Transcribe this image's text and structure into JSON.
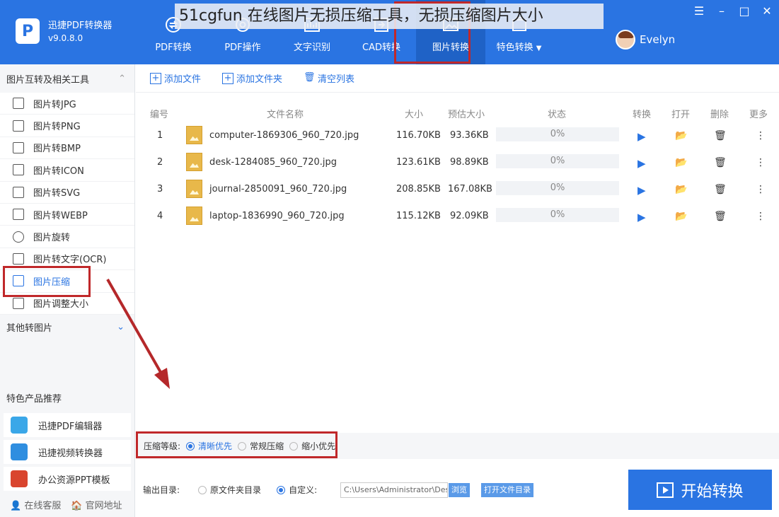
{
  "app": {
    "name": "迅捷PDF转换器",
    "version": "v9.0.8.0",
    "logo_letter": "P"
  },
  "watermark": "51cgfun 在线图片无损压缩工具，无损压缩图片大小",
  "nav": [
    {
      "label": "PDF转换",
      "icon": "convert-icon"
    },
    {
      "label": "PDF操作",
      "icon": "settings-icon"
    },
    {
      "label": "文字识别",
      "icon": "ocr-icon"
    },
    {
      "label": "CAD转换",
      "icon": "cad-icon"
    },
    {
      "label": "图片转换",
      "icon": "image-icon",
      "active": true
    },
    {
      "label": "特色转换",
      "icon": "special-icon",
      "dropdown": "▼"
    }
  ],
  "window_controls": {
    "menu": "☰",
    "minimize": "–",
    "maximize": "□",
    "close": "✕"
  },
  "user": {
    "name": "Evelyn"
  },
  "sidebar": {
    "section1": "图片互转及相关工具",
    "section1_toggle": "⌃",
    "items": [
      {
        "label": "图片转JPG"
      },
      {
        "label": "图片转PNG"
      },
      {
        "label": "图片转BMP"
      },
      {
        "label": "图片转ICON"
      },
      {
        "label": "图片转SVG"
      },
      {
        "label": "图片转WEBP"
      },
      {
        "label": "图片旋转"
      },
      {
        "label": "图片转文字(OCR)"
      },
      {
        "label": "图片压缩",
        "active": true
      },
      {
        "label": "图片调整大小"
      }
    ],
    "section2": "其他转图片",
    "section2_toggle": "⌄",
    "featured_title": "特色产品推荐",
    "featured": [
      {
        "label": "迅捷PDF编辑器",
        "color": "#3aa7e8"
      },
      {
        "label": "迅捷视频转换器",
        "color": "#2f8ee0"
      },
      {
        "label": "办公资源PPT模板",
        "color": "#d9452e"
      }
    ],
    "footer": {
      "service": "在线客服",
      "website": "官网地址"
    }
  },
  "toolbar": {
    "add_file": "添加文件",
    "add_folder": "添加文件夹",
    "clear_list": "清空列表",
    "add_glyph": "+",
    "clear_glyph": "🗑"
  },
  "table": {
    "headers": {
      "num": "编号",
      "name": "文件名称",
      "size": "大小",
      "est": "预估大小",
      "status": "状态",
      "convert": "转换",
      "open": "打开",
      "delete": "删除",
      "more": "更多"
    },
    "rows": [
      {
        "num": "1",
        "name": "computer-1869306_960_720.jpg",
        "size": "116.70KB",
        "est": "93.36KB",
        "status": "0%"
      },
      {
        "num": "2",
        "name": "desk-1284085_960_720.jpg",
        "size": "123.61KB",
        "est": "98.89KB",
        "status": "0%"
      },
      {
        "num": "3",
        "name": "journal-2850091_960_720.jpg",
        "size": "208.85KB",
        "est": "167.08KB",
        "status": "0%"
      },
      {
        "num": "4",
        "name": "laptop-1836990_960_720.jpg",
        "size": "115.12KB",
        "est": "92.09KB",
        "status": "0%"
      }
    ],
    "glyphs": {
      "play": "▶",
      "open": "📂",
      "delete": "🗑",
      "more": "⋮"
    }
  },
  "compression": {
    "label": "压缩等级:",
    "options": [
      "清晰优先",
      "常规压缩",
      "缩小优先"
    ],
    "selected": "清晰优先"
  },
  "output": {
    "label": "输出目录:",
    "opt_source": "原文件夹目录",
    "opt_custom": "自定义:",
    "path": "C:\\Users\\Administrator\\Desktop",
    "browse": "浏览",
    "open_folder": "打开文件目录"
  },
  "start_button": "开始转换",
  "colors": {
    "brand": "#2a74e2",
    "highlight": "#c0282a"
  }
}
